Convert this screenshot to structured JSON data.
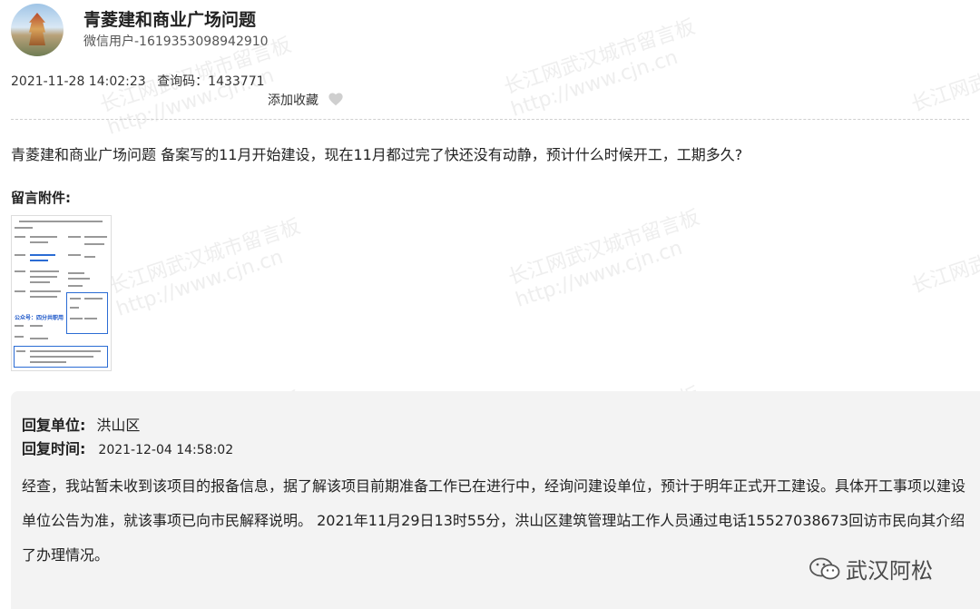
{
  "header": {
    "title": "青菱建和商业广场问题",
    "user": "微信用户-1619353098942910"
  },
  "meta": {
    "datetime": "2021-11-28 14:02:23",
    "query_code": "查询码：1433771",
    "favorite_label": "添加收藏",
    "favorite_icon": "heart-icon"
  },
  "question": "青菱建和商业广场问题  备案写的11月开始建设，现在11月都过完了快还没有动静，预计什么时候开工，工期多久?",
  "attachment": {
    "label": "留言附件:",
    "thumb_stamp": "公众号：四分共职用"
  },
  "reply": {
    "unit_label": "回复单位:",
    "unit_value": "洪山区",
    "time_label": "回复时间:",
    "time_value": "2021-12-04 14:58:02",
    "text": " 经查，我站暂未收到该项目的报备信息，据了解该项目前期准备工作已在进行中，经询问建设单位，预计于明年正式开工建设。具体开工事项以建设单位公告为准，就该事项已向市民解释说明。 2021年11月29日13时55分，洪山区建筑管理站工作人员通过电话15527038673回访市民向其介绍了办理情况。"
  },
  "brand": {
    "text": "武汉阿松",
    "icon": "wechat-icon"
  },
  "watermark": {
    "line1": "长江网武汉城市留言板",
    "line2": "http://www.cjn.cn"
  },
  "colors": {
    "reply_bg": "#f3f3f3",
    "separator": "#cfcfcf"
  }
}
